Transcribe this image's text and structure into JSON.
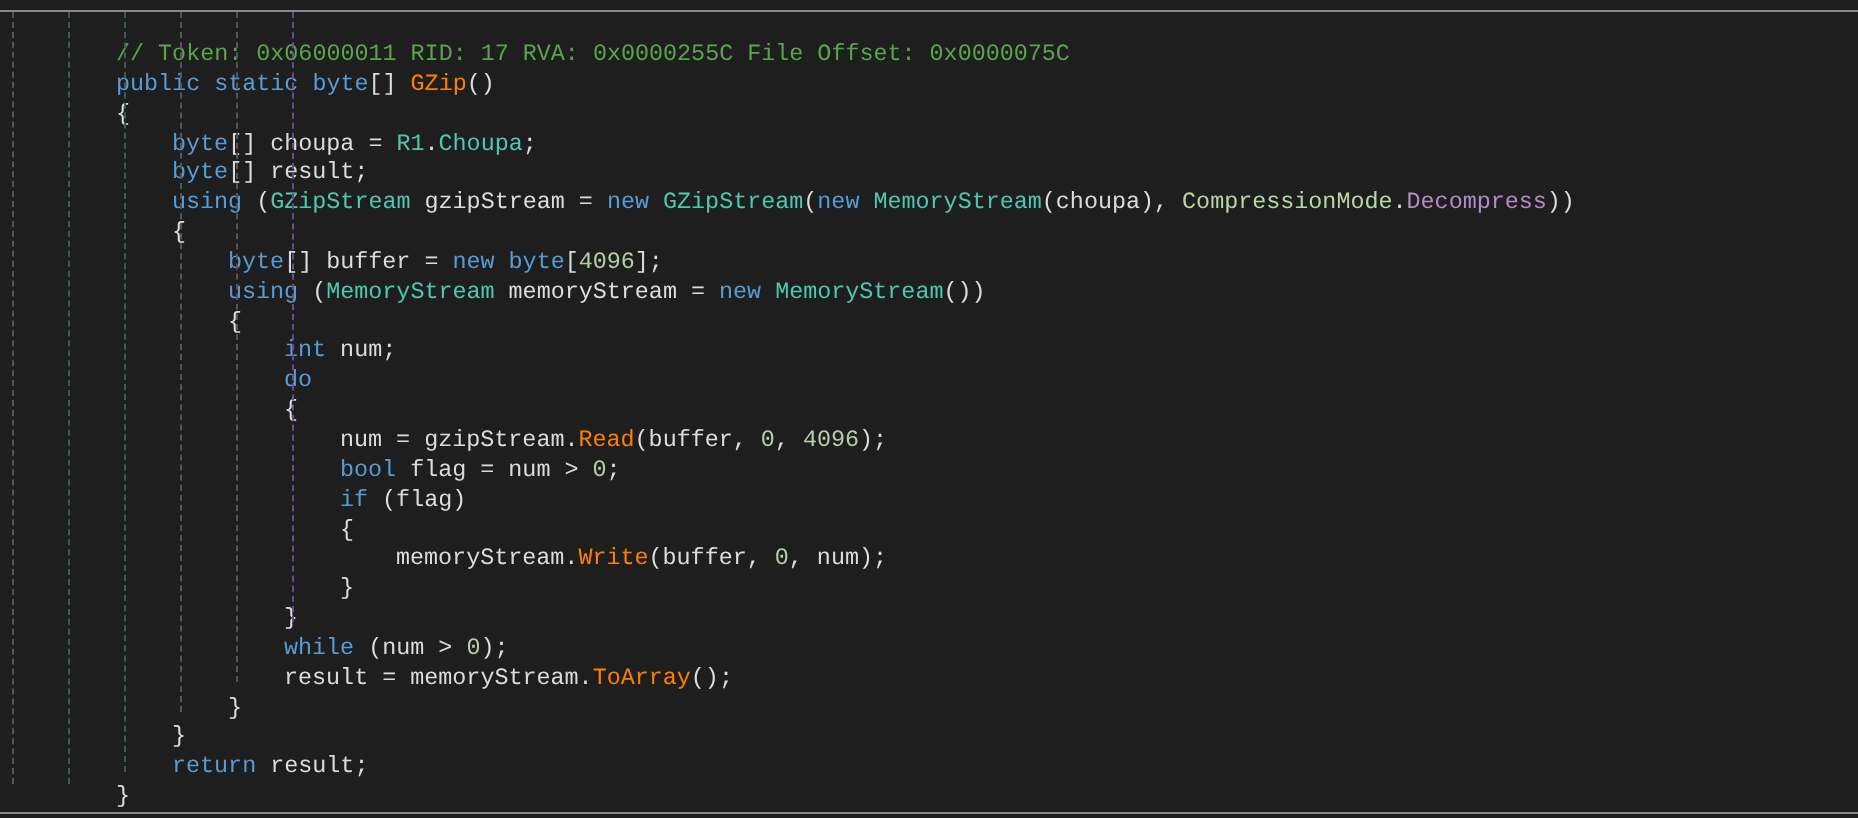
{
  "editor": {
    "lines": [
      {
        "tokens": [
          {
            "kind": "comment",
            "text": "// Token: 0x06000011 RID: 17 RVA: 0x0000255C File Offset: 0x0000075C"
          }
        ]
      },
      {
        "tokens": [
          {
            "kind": "keyword",
            "text": "public static byte"
          },
          {
            "kind": "plain",
            "text": "[] "
          },
          {
            "kind": "method",
            "text": "GZip"
          },
          {
            "kind": "plain",
            "text": "()"
          }
        ]
      },
      {
        "tokens": [
          {
            "kind": "plain",
            "text": "{"
          }
        ],
        "children": [
          {
            "tokens": [
              {
                "kind": "keyword",
                "text": "byte"
              },
              {
                "kind": "plain",
                "text": "[] choupa = "
              },
              {
                "kind": "type",
                "text": "R1"
              },
              {
                "kind": "plain",
                "text": "."
              },
              {
                "kind": "property",
                "text": "Choupa"
              },
              {
                "kind": "plain",
                "text": ";"
              }
            ]
          },
          {
            "tokens": [
              {
                "kind": "keyword",
                "text": "byte"
              },
              {
                "kind": "plain",
                "text": "[] result;"
              }
            ]
          },
          {
            "tokens": [
              {
                "kind": "keyword",
                "text": "using"
              },
              {
                "kind": "plain",
                "text": " ("
              },
              {
                "kind": "type",
                "text": "GZipStream"
              },
              {
                "kind": "plain",
                "text": " gzipStream = "
              },
              {
                "kind": "keyword",
                "text": "new "
              },
              {
                "kind": "type",
                "text": "GZipStream"
              },
              {
                "kind": "plain",
                "text": "("
              },
              {
                "kind": "keyword",
                "text": "new "
              },
              {
                "kind": "type",
                "text": "MemoryStream"
              },
              {
                "kind": "plain",
                "text": "(choupa), "
              },
              {
                "kind": "enum",
                "text": "CompressionMode"
              },
              {
                "kind": "plain",
                "text": "."
              },
              {
                "kind": "member",
                "text": "Decompress"
              },
              {
                "kind": "plain",
                "text": "))"
              }
            ]
          },
          {
            "tokens": [
              {
                "kind": "plain",
                "text": "{"
              }
            ],
            "children": [
              {
                "tokens": [
                  {
                    "kind": "keyword",
                    "text": "byte"
                  },
                  {
                    "kind": "plain",
                    "text": "[] buffer = "
                  },
                  {
                    "kind": "keyword",
                    "text": "new byte"
                  },
                  {
                    "kind": "plain",
                    "text": "["
                  },
                  {
                    "kind": "number",
                    "text": "4096"
                  },
                  {
                    "kind": "plain",
                    "text": "];"
                  }
                ]
              },
              {
                "tokens": [
                  {
                    "kind": "keyword",
                    "text": "using"
                  },
                  {
                    "kind": "plain",
                    "text": " ("
                  },
                  {
                    "kind": "type",
                    "text": "MemoryStream"
                  },
                  {
                    "kind": "plain",
                    "text": " memoryStream = "
                  },
                  {
                    "kind": "keyword",
                    "text": "new "
                  },
                  {
                    "kind": "type",
                    "text": "MemoryStream"
                  },
                  {
                    "kind": "plain",
                    "text": "())"
                  }
                ]
              },
              {
                "tokens": [
                  {
                    "kind": "plain",
                    "text": "{"
                  }
                ],
                "children": [
                  {
                    "tokens": [
                      {
                        "kind": "keyword",
                        "text": "int"
                      },
                      {
                        "kind": "plain",
                        "text": " num;"
                      }
                    ]
                  },
                  {
                    "tokens": [
                      {
                        "kind": "keyword",
                        "text": "do"
                      }
                    ]
                  },
                  {
                    "tokens": [
                      {
                        "kind": "plain",
                        "text": "{"
                      }
                    ],
                    "children": [
                      {
                        "tokens": [
                          {
                            "kind": "plain",
                            "text": "num = gzipStream."
                          },
                          {
                            "kind": "method",
                            "text": "Read"
                          },
                          {
                            "kind": "plain",
                            "text": "(buffer, "
                          },
                          {
                            "kind": "number",
                            "text": "0"
                          },
                          {
                            "kind": "plain",
                            "text": ", "
                          },
                          {
                            "kind": "number",
                            "text": "4096"
                          },
                          {
                            "kind": "plain",
                            "text": ");"
                          }
                        ]
                      },
                      {
                        "tokens": [
                          {
                            "kind": "keyword",
                            "text": "bool"
                          },
                          {
                            "kind": "plain",
                            "text": " flag = num > "
                          },
                          {
                            "kind": "number",
                            "text": "0"
                          },
                          {
                            "kind": "plain",
                            "text": ";"
                          }
                        ]
                      },
                      {
                        "tokens": [
                          {
                            "kind": "keyword",
                            "text": "if"
                          },
                          {
                            "kind": "plain",
                            "text": " (flag)"
                          }
                        ]
                      },
                      {
                        "tokens": [
                          {
                            "kind": "plain",
                            "text": "{"
                          }
                        ],
                        "children": [
                          {
                            "tokens": [
                              {
                                "kind": "plain",
                                "text": "memoryStream."
                              },
                              {
                                "kind": "method",
                                "text": "Write"
                              },
                              {
                                "kind": "plain",
                                "text": "(buffer, "
                              },
                              {
                                "kind": "number",
                                "text": "0"
                              },
                              {
                                "kind": "plain",
                                "text": ", num);"
                              }
                            ]
                          }
                        ]
                      },
                      {
                        "tokens": [
                          {
                            "kind": "plain",
                            "text": "}"
                          }
                        ]
                      }
                    ]
                  },
                  {
                    "tokens": [
                      {
                        "kind": "plain",
                        "text": "}"
                      }
                    ]
                  },
                  {
                    "tokens": [
                      {
                        "kind": "keyword",
                        "text": "while"
                      },
                      {
                        "kind": "plain",
                        "text": " (num > "
                      },
                      {
                        "kind": "number",
                        "text": "0"
                      },
                      {
                        "kind": "plain",
                        "text": ");"
                      }
                    ]
                  },
                  {
                    "tokens": [
                      {
                        "kind": "plain",
                        "text": "result = memoryStream."
                      },
                      {
                        "kind": "method",
                        "text": "ToArray"
                      },
                      {
                        "kind": "plain",
                        "text": "();"
                      }
                    ]
                  }
                ]
              },
              {
                "tokens": [
                  {
                    "kind": "plain",
                    "text": "}"
                  }
                ]
              }
            ]
          },
          {
            "tokens": [
              {
                "kind": "plain",
                "text": "}"
              }
            ]
          },
          {
            "tokens": [
              {
                "kind": "keyword",
                "text": "return"
              },
              {
                "kind": "plain",
                "text": " result;"
              }
            ]
          }
        ]
      },
      {
        "tokens": [
          {
            "kind": "plain",
            "text": "}"
          }
        ]
      }
    ]
  }
}
